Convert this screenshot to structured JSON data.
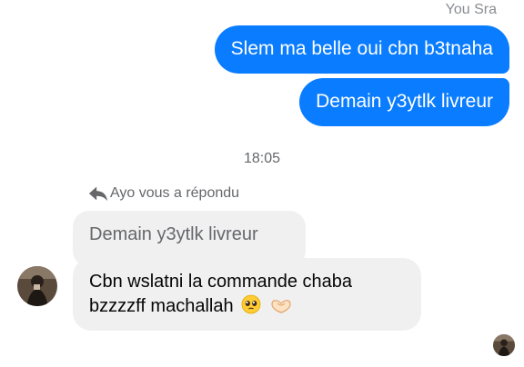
{
  "thread": {
    "sender_label": "You Sra",
    "outgoing": [
      "Slem ma belle oui cbn b3tnaha",
      "Demain y3ytlk livreur"
    ],
    "timestamp": "18:05",
    "reply_indicator": "Ayo vous a répondu",
    "quoted_text": "Demain y3ytlk livreur",
    "incoming_line1": "Cbn wslatni la commande chaba",
    "incoming_line2": "bzzzzff machallah",
    "incoming_emojis": [
      "pleading-face-emoji",
      "heart-hands-emoji"
    ]
  },
  "icons": [
    "reply-arrow-icon"
  ],
  "colors": {
    "outgoing_bubble": "#0a7cff",
    "incoming_bubble": "#f0f0f0",
    "meta_text": "#65676b"
  }
}
